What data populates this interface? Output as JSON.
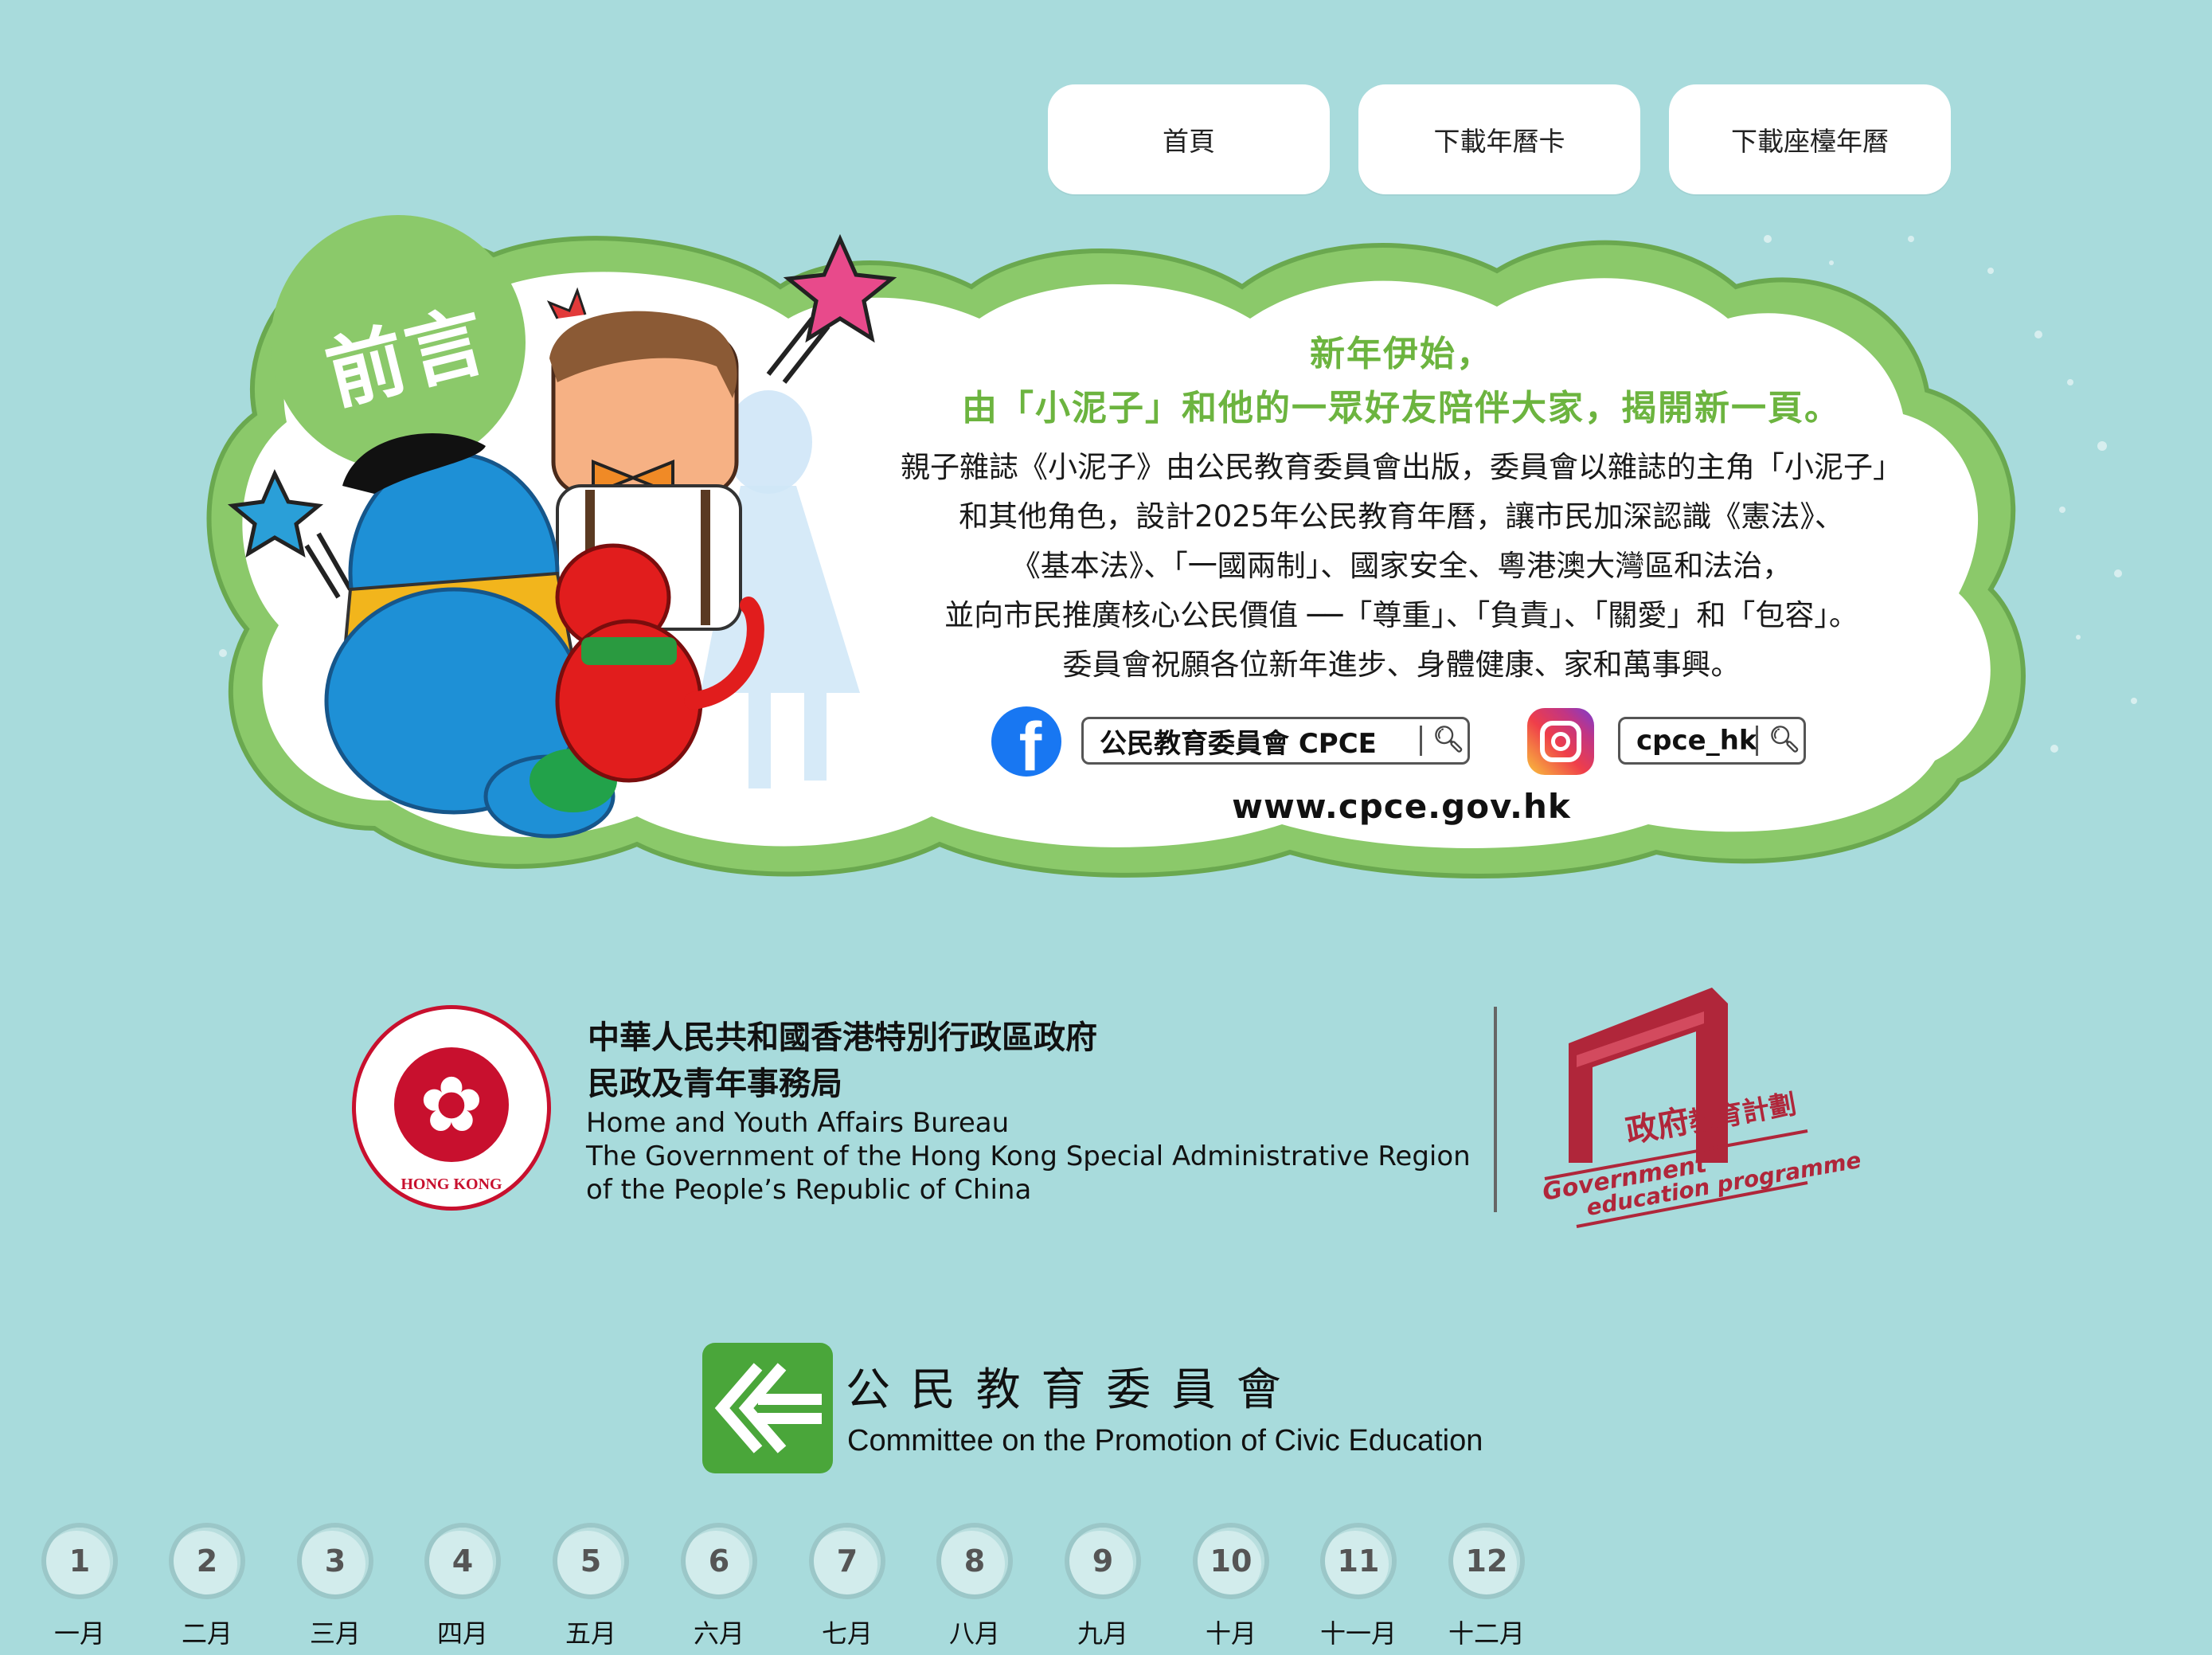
{
  "nav": {
    "home": "首頁",
    "download_card": "下載年曆卡",
    "download_desk": "下載座檯年曆"
  },
  "foreword": {
    "badge": "前言",
    "headline1": "新年伊始，",
    "headline2": "由「小泥子」和他的一眾好友陪伴大家，揭開新一頁。",
    "lines": [
      "親子雜誌《小泥子》由公民教育委員會出版，委員會以雜誌的主角「小泥子」",
      "和其他角色，設計2025年公民教育年曆，讓市民加深認識《憲法》、",
      "《基本法》、「一國兩制」、國家安全、粵港澳大灣區和法治，",
      "並向市民推廣核心公民價值 ──「尊重」、「負責」、「關愛」和「包容」。",
      "委員會祝願各位新年進步、身體健康、家和萬事興。"
    ],
    "facebook_search": "公民教育委員會 CPCE",
    "instagram_search": "cpce_hk",
    "website": "www.cpce.gov.hk"
  },
  "gov": {
    "cn1": "中華人民共和國香港特別行政區政府",
    "cn2": "民政及青年事務局",
    "en1": "Home and Youth Affairs Bureau",
    "en2": "The Government of the Hong Kong Special Administrative Region",
    "en3": "of the People’s Republic of China",
    "emblem_text": "中華人民共和國香港特別行政區",
    "emblem_bottom": "HONG KONG",
    "gep_cn_a": "政府",
    "gep_cn_b": "教育計劃",
    "gep_en1": "Government",
    "gep_en2": "education programme"
  },
  "cpce": {
    "cn": "公 民 教 育 委 員 會",
    "en": "Committee on the Promotion of Civic Education"
  },
  "months": [
    {
      "num": "1",
      "label": "一月"
    },
    {
      "num": "2",
      "label": "二月"
    },
    {
      "num": "3",
      "label": "三月"
    },
    {
      "num": "4",
      "label": "四月"
    },
    {
      "num": "5",
      "label": "五月"
    },
    {
      "num": "6",
      "label": "六月"
    },
    {
      "num": "7",
      "label": "七月"
    },
    {
      "num": "8",
      "label": "八月"
    },
    {
      "num": "9",
      "label": "九月"
    },
    {
      "num": "10",
      "label": "十月"
    },
    {
      "num": "11",
      "label": "十一月"
    },
    {
      "num": "12",
      "label": "十二月"
    }
  ],
  "colors": {
    "background": "#a8dbdc",
    "cloud_green": "#8bc96a",
    "headline_green": "#6cb43f",
    "gov_red": "#b0263a",
    "cpce_green": "#4aa63a"
  }
}
